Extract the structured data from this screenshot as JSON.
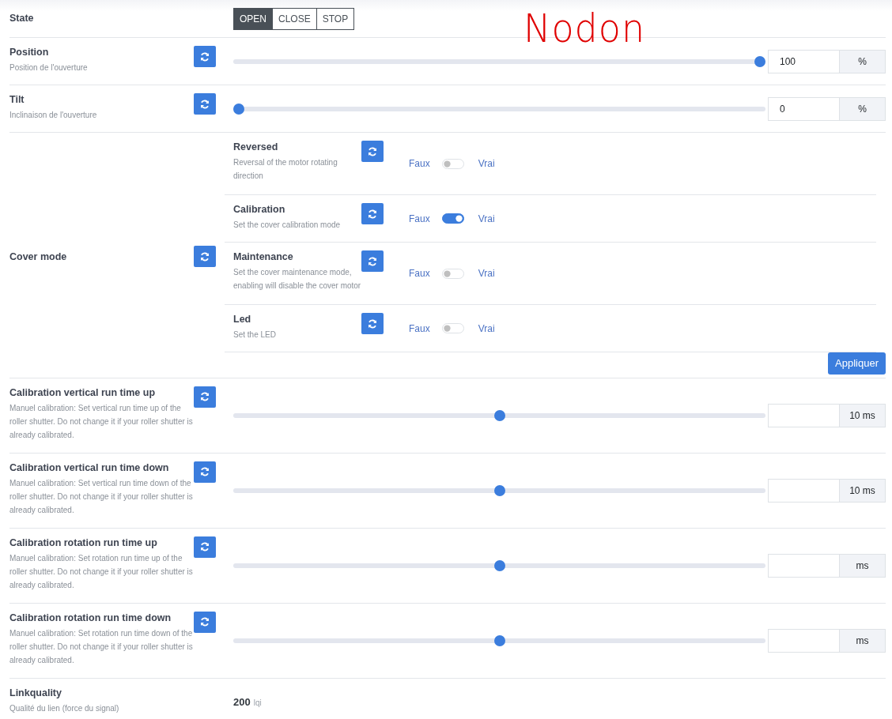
{
  "annotation": {
    "text": "Nodon"
  },
  "state": {
    "label": "State",
    "options": [
      {
        "label": "OPEN",
        "selected": true
      },
      {
        "label": "CLOSE",
        "selected": false
      },
      {
        "label": "STOP",
        "selected": false
      }
    ]
  },
  "rows": [
    {
      "kind": "slider",
      "label": "Position",
      "description": "Position de l'ouverture",
      "level": 1,
      "value": "100",
      "unit": "%"
    },
    {
      "kind": "slider",
      "label": "Tilt",
      "description": "Inclinaison de l'ouverture",
      "level": 0,
      "value": "0",
      "unit": "%"
    },
    {
      "kind": "composite",
      "label": "Cover mode",
      "apply_button": "Appliquer",
      "items": [
        {
          "label": "Reversed",
          "description": "Reversal of the motor rotating direction",
          "off_label": "Faux",
          "on_label": "Vrai",
          "on": false
        },
        {
          "label": "Calibration",
          "description": "Set the cover calibration mode",
          "off_label": "Faux",
          "on_label": "Vrai",
          "on": true
        },
        {
          "label": "Maintenance",
          "description": "Set the cover maintenance mode, enabling will disable the cover motor",
          "off_label": "Faux",
          "on_label": "Vrai",
          "on": false
        },
        {
          "label": "Led",
          "description": "Set the LED",
          "off_label": "Faux",
          "on_label": "Vrai",
          "on": false
        }
      ]
    },
    {
      "kind": "slider",
      "label": "Calibration vertical run time up",
      "description": "Manuel calibration: Set vertical run time up of the roller shutter. Do not change it if your roller shutter is already calibrated.",
      "level": 0.5,
      "unit": "10 ms"
    },
    {
      "kind": "slider",
      "label": "Calibration vertical run time down",
      "description": "Manuel calibration: Set vertical run time down of the roller shutter. Do not change it if your roller shutter is already calibrated.",
      "level": 0.5,
      "unit": "10 ms"
    },
    {
      "kind": "slider",
      "label": "Calibration rotation run time up",
      "description": "Manuel calibration: Set rotation run time up of the roller shutter. Do not change it if your roller shutter is already calibrated.",
      "level": 0.5,
      "unit": "ms"
    },
    {
      "kind": "slider",
      "label": "Calibration rotation run time down",
      "description": "Manuel calibration: Set rotation run time down of the roller shutter. Do not change it if your roller shutter is already calibrated.",
      "level": 0.5,
      "unit": "ms"
    },
    {
      "kind": "readout",
      "label": "Linkquality",
      "description": "Qualité du lien (force du signal)",
      "value": "200",
      "unit": "lqi"
    }
  ]
}
